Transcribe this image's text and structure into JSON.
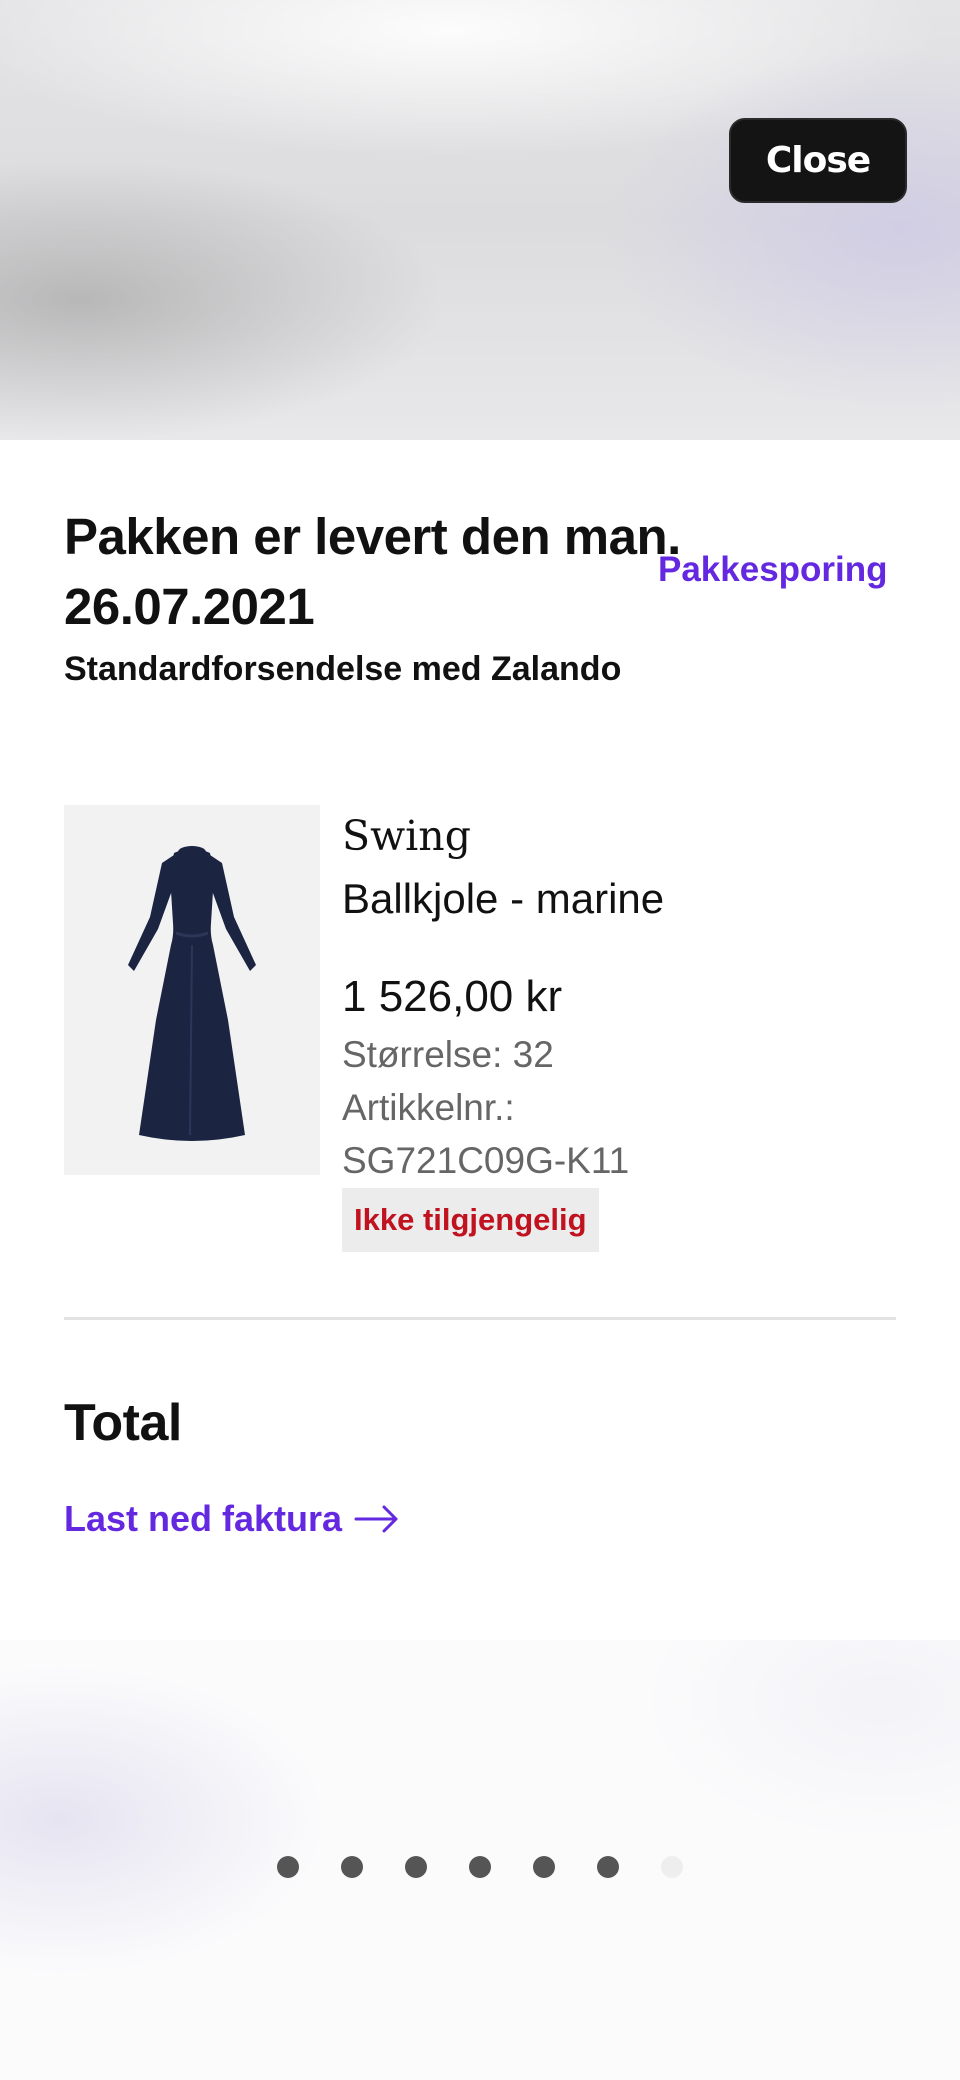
{
  "header": {
    "close_label": "Close"
  },
  "delivery": {
    "title": "Pakken er levert den man. 26.07.2021",
    "tracking_link": "Pakkesporing",
    "shipping_method": "Standardforsendelse med Zalando"
  },
  "product": {
    "brand": "Swing",
    "name": "Ballkjole - marine",
    "price": "1 526,00 kr",
    "size": "Størrelse: 32",
    "article_label": "Artikkelnr.:",
    "article_number": "SG721C09G-K11",
    "availability": "Ikke tilgjengelig",
    "image_icon": "dress-image",
    "color": "#1b2440"
  },
  "total": {
    "heading": "Total",
    "invoice_link": "Last ned faktura"
  },
  "pager": {
    "count": 7,
    "active_count": 6
  },
  "colors": {
    "accent": "#6328e0",
    "unavailable": "#c1121f",
    "close_bg": "#141414"
  }
}
